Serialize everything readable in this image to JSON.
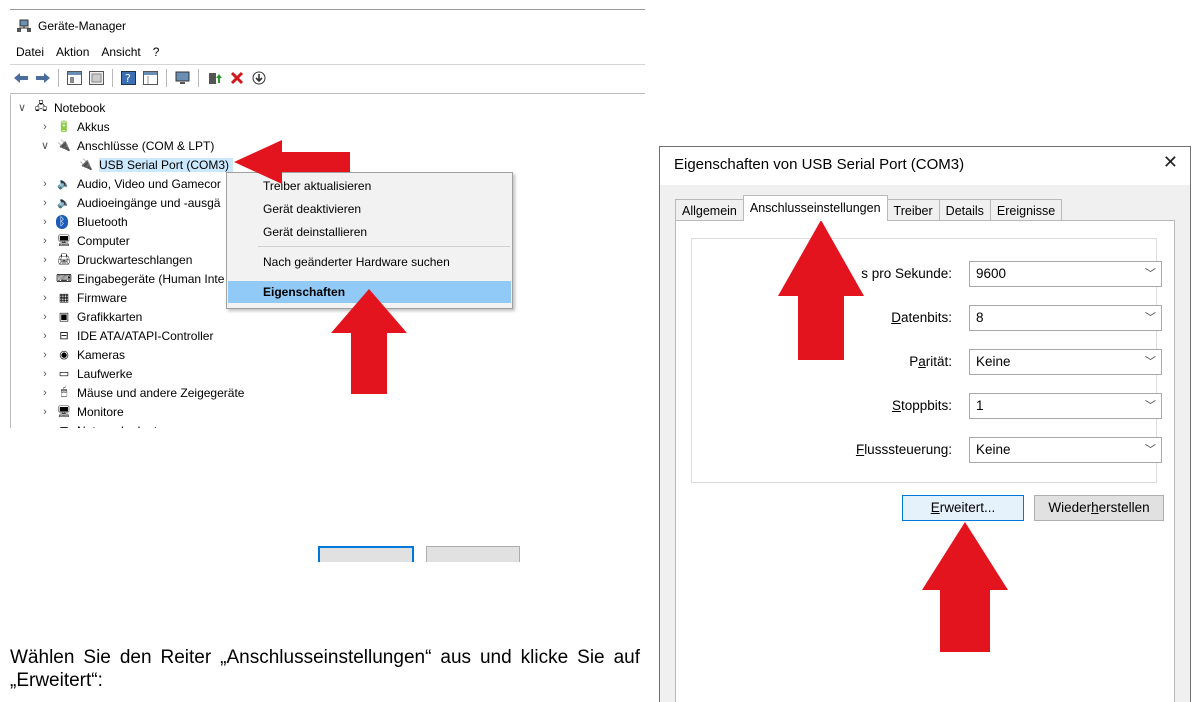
{
  "device_manager": {
    "title": "Geräte-Manager",
    "menu": [
      "Datei",
      "Aktion",
      "Ansicht",
      "?"
    ],
    "tree": [
      {
        "label": "Notebook",
        "chevron": "∨",
        "icon": "computer-icon"
      },
      {
        "label": "Akkus",
        "chevron": "›",
        "icon": "battery-icon"
      },
      {
        "label": "Anschlüsse (COM & LPT)",
        "chevron": "∨",
        "icon": "port-icon"
      },
      {
        "label": "USB Serial Port (COM3)",
        "chevron": "",
        "icon": "port-icon"
      },
      {
        "label": "Audio, Video und Gamecor",
        "chevron": "›",
        "icon": "speaker-icon"
      },
      {
        "label": "Audioeingänge und -ausgä",
        "chevron": "›",
        "icon": "speaker-icon"
      },
      {
        "label": "Bluetooth",
        "chevron": "›",
        "icon": "bluetooth-icon"
      },
      {
        "label": "Computer",
        "chevron": "›",
        "icon": "monitor-icon"
      },
      {
        "label": "Druckwarteschlangen",
        "chevron": "›",
        "icon": "printer-icon"
      },
      {
        "label": "Eingabegeräte (Human Inte",
        "chevron": "›",
        "icon": "keyboard-icon"
      },
      {
        "label": "Firmware",
        "chevron": "›",
        "icon": "firmware-icon"
      },
      {
        "label": "Grafikkarten",
        "chevron": "›",
        "icon": "display-adapter-icon"
      },
      {
        "label": "IDE ATA/ATAPI-Controller",
        "chevron": "›",
        "icon": "controller-icon"
      },
      {
        "label": "Kameras",
        "chevron": "›",
        "icon": "camera-icon"
      },
      {
        "label": "Laufwerke",
        "chevron": "›",
        "icon": "drive-icon"
      },
      {
        "label": "Mäuse und andere Zeigegeräte",
        "chevron": "›",
        "icon": "mouse-icon"
      },
      {
        "label": "Monitore",
        "chevron": "›",
        "icon": "monitor-icon"
      },
      {
        "label": "Netzwerkadapter",
        "chevron": "›",
        "icon": "network-icon"
      }
    ],
    "context_menu": {
      "items": [
        "Treiber aktualisieren",
        "Gerät deaktivieren",
        "Gerät deinstallieren",
        "Nach geänderter Hardware suchen",
        "Eigenschaften"
      ],
      "highlighted": "Eigenschaften"
    }
  },
  "instruction": "Wählen Sie den Reiter „Anschlusseinstellungen“ aus und klicke Sie auf „Erweitert“:",
  "dialog": {
    "title": "Eigenschaften von USB Serial Port (COM3)",
    "tabs": [
      "Allgemein",
      "Anschlusseinstellungen",
      "Treiber",
      "Details",
      "Ereignisse"
    ],
    "active_tab": "Anschlusseinstellungen",
    "fields": [
      {
        "label": "Bits pro Sekunde:",
        "visible_label": "s pro Sekunde:",
        "value": "9600"
      },
      {
        "label_u": "D",
        "label_rest": "atenbits:",
        "value": "8"
      },
      {
        "label_pre": "P",
        "label_u": "a",
        "label_rest": "rität:",
        "value": "Keine"
      },
      {
        "label_u": "S",
        "label_rest": "toppbits:",
        "value": "1"
      },
      {
        "label_u": "F",
        "label_rest": "lusssteuerung:",
        "value": "Keine"
      }
    ],
    "buttons": {
      "advanced_u": "E",
      "advanced_rest": "rweitert...",
      "restore_pre": "Wieder",
      "restore_u": "h",
      "restore_rest": "erstellen"
    }
  },
  "colors": {
    "arrow_red": "#e3141d",
    "selection": "#cce8ff",
    "menu_highlight": "#91c9f7",
    "focus_blue": "#0078d7"
  }
}
